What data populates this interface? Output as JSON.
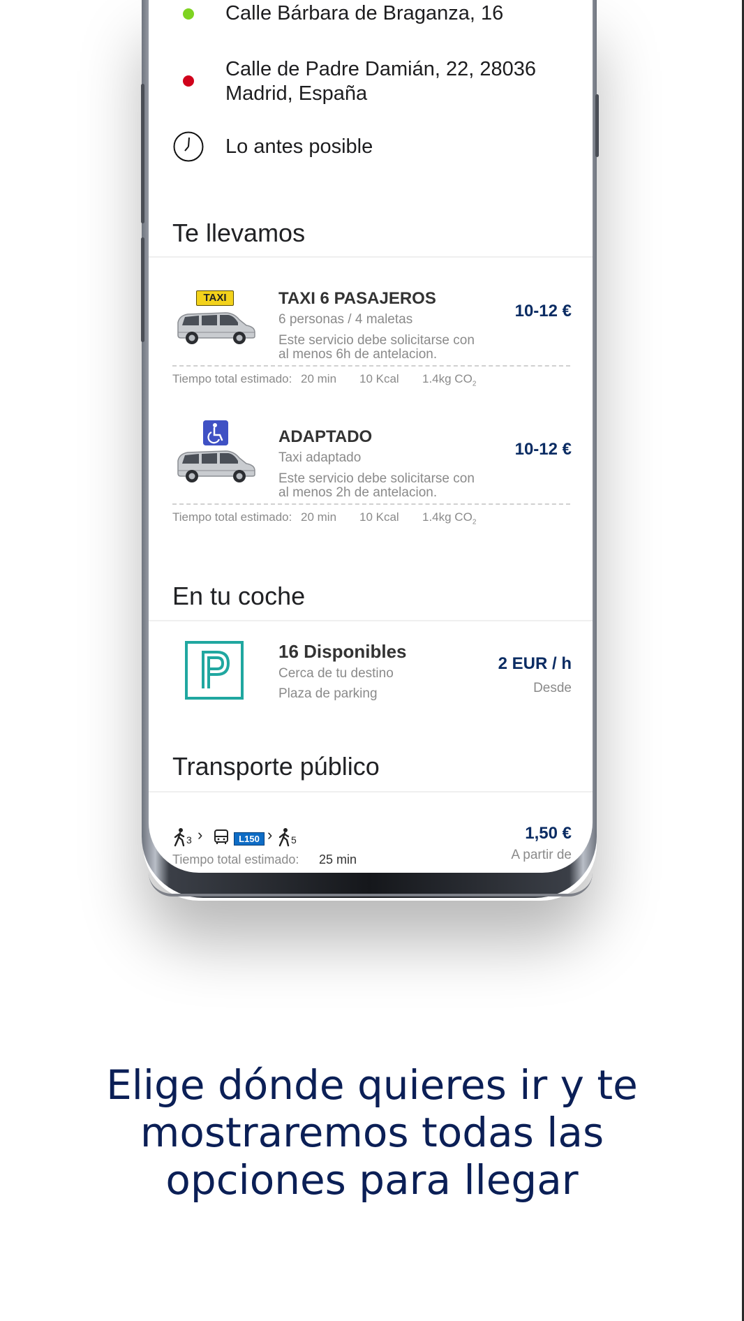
{
  "route": {
    "origin": "Calle Bárbara de Braganza, 16",
    "destination_line1": "Calle de Padre Damián, 22, 28036",
    "destination_line2": "Madrid, España",
    "time": "Lo antes posible",
    "origin_color": "#7ed321",
    "destination_color": "#d0021b"
  },
  "sections": {
    "taxi": "Te llevamos",
    "car": "En tu coche",
    "public": "Transporte público"
  },
  "taxi_options": [
    {
      "badge": "TAXI",
      "title": "TAXI 6 PASAJEROS",
      "subtitle": "6 personas / 4 maletas",
      "desc_line1": "Este servicio debe solicitarse con",
      "desc_line2": "al menos 6h de antelacion.",
      "price": "10-12 €",
      "meta_label": "Tiempo total estimado:",
      "meta_time": "20 min",
      "meta_kcal": "10 Kcal",
      "meta_co2": "1.4kg CO",
      "meta_co2_sub": "2"
    },
    {
      "badge_icon": "wheelchair-icon",
      "title": "ADAPTADO",
      "subtitle": "Taxi adaptado",
      "desc_line1": "Este servicio debe solicitarse con",
      "desc_line2": "al menos 2h de antelacion.",
      "price": "10-12 €",
      "meta_label": "Tiempo total estimado:",
      "meta_time": "20 min",
      "meta_kcal": "10 Kcal",
      "meta_co2": "1.4kg CO",
      "meta_co2_sub": "2"
    }
  ],
  "parking": {
    "title": "16 Disponibles",
    "line1": "Cerca de tu destino",
    "line2": "Plaza de parking",
    "price": "2 EUR / h",
    "price_sub": "Desde",
    "accent": "#20a7a0"
  },
  "transit": {
    "walk1": "3",
    "line": "L150",
    "walk2": "5",
    "meta_label": "Tiempo total estimado:",
    "meta_time": "25 min",
    "price": "1,50 €",
    "price_sub": "A partir de"
  },
  "tagline": {
    "line1": "Elige dónde quieres ir y te",
    "line2": "mostraremos todas las",
    "line3": "opciones para llegar"
  },
  "colors": {
    "price": "#0b2c63",
    "tagline": "#0b1f56",
    "bus_line": "#0e6cc5"
  }
}
